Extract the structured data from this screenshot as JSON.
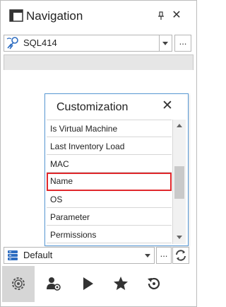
{
  "window": {
    "title": "Navigation",
    "pin_glyph": "⌹",
    "close_glyph": "✕"
  },
  "server": {
    "value": "SQL414",
    "icon": "server-connection-icon",
    "ellipsis": "..."
  },
  "customization": {
    "title": "Customization",
    "close_glyph": "✕",
    "items": [
      {
        "label": "Is Virtual Machine",
        "selected": false
      },
      {
        "label": "Last Inventory Load",
        "selected": false
      },
      {
        "label": "MAC",
        "selected": false
      },
      {
        "label": "Name",
        "selected": true
      },
      {
        "label": "OS",
        "selected": false
      },
      {
        "label": "Parameter",
        "selected": false
      },
      {
        "label": "Permissions",
        "selected": false
      }
    ],
    "highlight_color": "#e0282c",
    "border_color": "#5a9ad6"
  },
  "layout": {
    "value": "Default",
    "icon": "database-icon",
    "ellipsis": "..."
  },
  "toolbar": {
    "buttons": [
      {
        "icon": "settings-gear-icon",
        "active": true
      },
      {
        "icon": "user-settings-icon",
        "active": false
      },
      {
        "icon": "play-icon",
        "active": false
      },
      {
        "icon": "star-icon",
        "active": false
      },
      {
        "icon": "history-icon",
        "active": false
      }
    ]
  }
}
